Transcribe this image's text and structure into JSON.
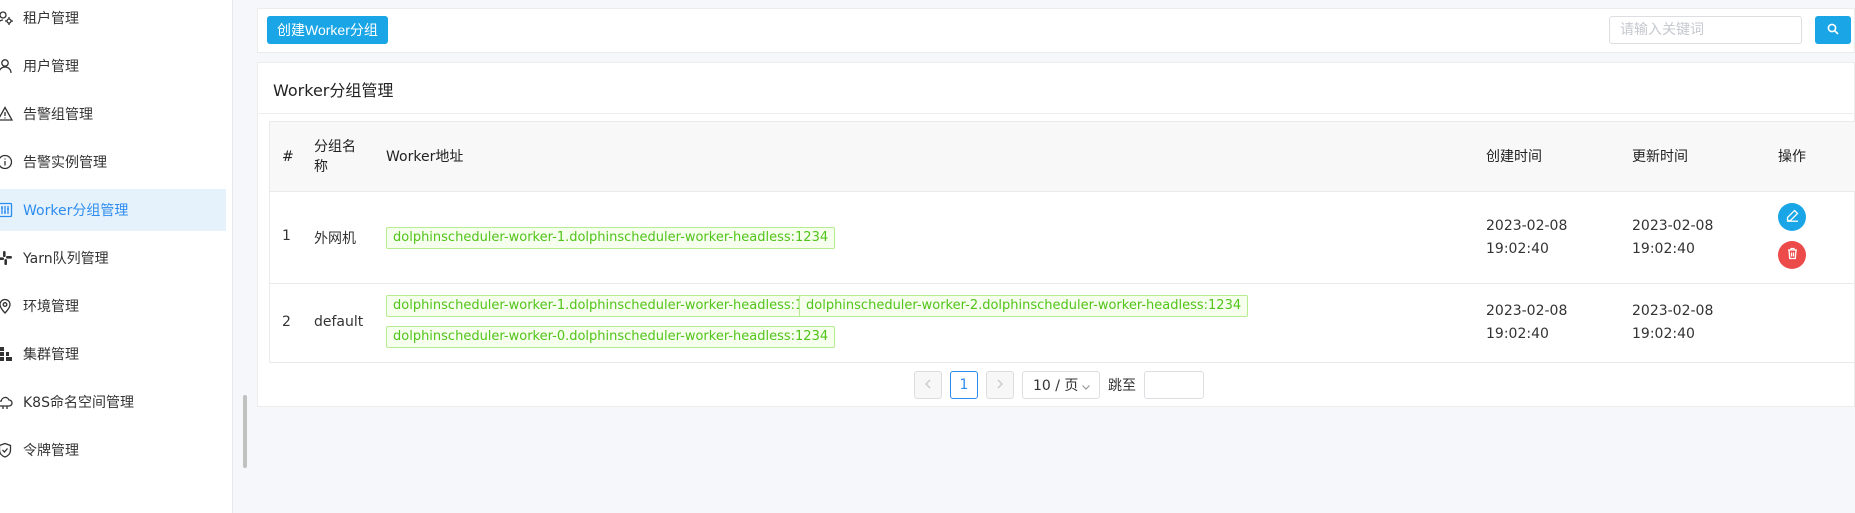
{
  "sidebar": {
    "items": [
      {
        "label": "租户管理",
        "icon": "tenant-icon"
      },
      {
        "label": "用户管理",
        "icon": "user-icon"
      },
      {
        "label": "告警组管理",
        "icon": "warning-icon"
      },
      {
        "label": "告警实例管理",
        "icon": "info-icon"
      },
      {
        "label": "Worker分组管理",
        "icon": "worker-group-icon",
        "active": true
      },
      {
        "label": "Yarn队列管理",
        "icon": "slack-icon"
      },
      {
        "label": "环境管理",
        "icon": "location-icon"
      },
      {
        "label": "集群管理",
        "icon": "cluster-icon"
      },
      {
        "label": "K8S命名空间管理",
        "icon": "cloud-icon"
      },
      {
        "label": "令牌管理",
        "icon": "shield-icon"
      }
    ]
  },
  "toolbar": {
    "create_label": "创建Worker分组",
    "search_placeholder": "请输入关键词"
  },
  "card": {
    "title": "Worker分组管理"
  },
  "table": {
    "headers": {
      "index": "#",
      "name": "分组名称",
      "addr": "Worker地址",
      "create_time": "创建时间",
      "update_time": "更新时间",
      "ops": "操作"
    },
    "rows": [
      {
        "index": "1",
        "name": "外网机",
        "addresses": [
          "dolphinscheduler-worker-1.dolphinscheduler-worker-headless:1234"
        ],
        "create_time": "2023-02-08 19:02:40",
        "update_time": "2023-02-08 19:02:40"
      },
      {
        "index": "2",
        "name": "default",
        "addresses": [
          "dolphinscheduler-worker-1.dolphinscheduler-worker-headless:1234",
          "dolphinscheduler-worker-2.dolphinscheduler-worker-headless:1234",
          "dolphinscheduler-worker-0.dolphinscheduler-worker-headless:1234"
        ],
        "create_time": "2023-02-08 19:02:40",
        "update_time": "2023-02-08 19:02:40"
      }
    ]
  },
  "pagination": {
    "current_page": "1",
    "page_size": "10 / 页",
    "jump_label": "跳至"
  },
  "colors": {
    "accent": "#1aa6e6",
    "active_bg": "#e6f2fb",
    "danger": "#ed4a4a",
    "tag_green": "#52c41a"
  }
}
